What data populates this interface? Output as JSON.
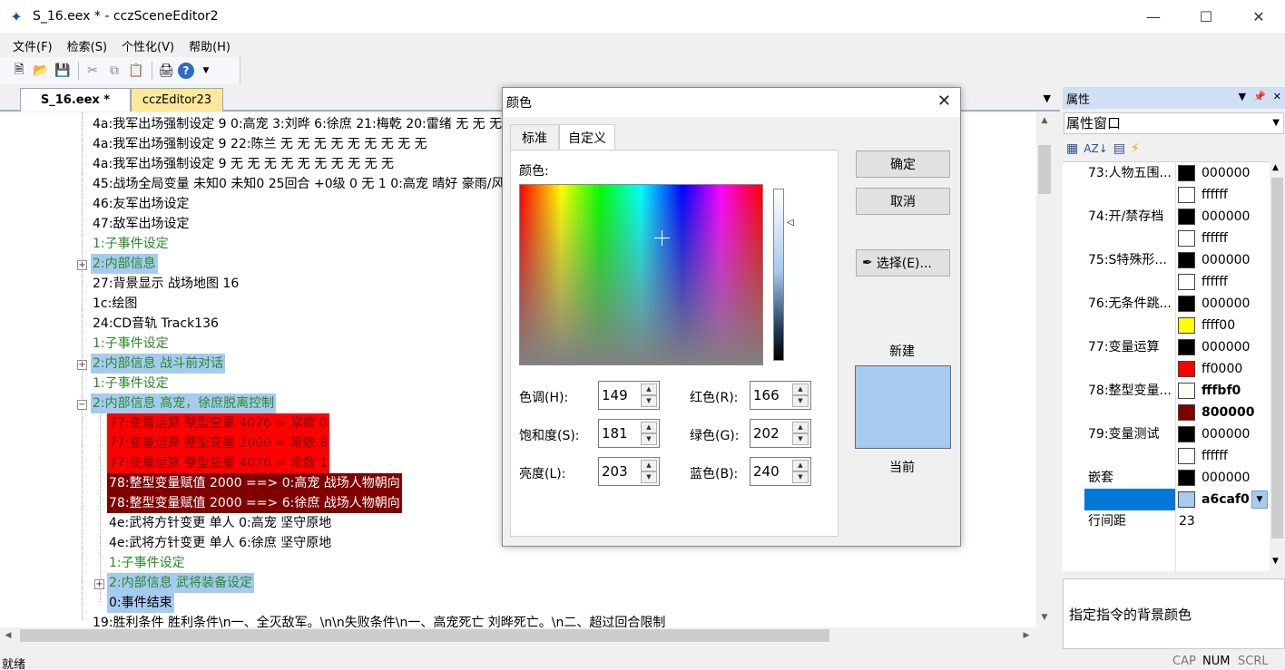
{
  "window": {
    "title": "S_16.eex * - cczSceneEditor2"
  },
  "menu": [
    "文件(F)",
    "检索(S)",
    "个性化(V)",
    "帮助(H)"
  ],
  "tabs": {
    "active": "S_16.eex *",
    "inactive": "cczEditor23"
  },
  "tree": [
    {
      "text": "4a:我军出场强制设定 9 0:高宠 3:刘晔 6:徐庶 21:梅乾 20:雷绪 无 无 无 无 无"
    },
    {
      "text": "4a:我军出场强制设定 9 22:陈兰 无 无 无 无 无 无 无 无 无"
    },
    {
      "text": "4a:我军出场强制设定 9 无 无 无 无 无 无 无 无 无 无"
    },
    {
      "text": "45:战场全局变量 未知0 未知0 25回合 +0级 0 无 1 0:高宠 晴好 豪雨/风"
    },
    {
      "text": "46:友军出场设定"
    },
    {
      "text": "47:敌军出场设定"
    },
    {
      "text": "1:子事件设定"
    },
    {
      "text": "2:内部信息"
    },
    {
      "text": "27:背景显示 战场地图  16"
    },
    {
      "text": "1c:绘图"
    },
    {
      "text": "24:CD音轨 Track136"
    },
    {
      "text": "1:子事件设定"
    },
    {
      "text": "2:内部信息 战斗前对话"
    },
    {
      "text": "1:子事件设定"
    },
    {
      "text": "2:内部信息 高宠，徐庶脱离控制"
    },
    {
      "text": "77:变量运算 整型变量 4076 = 常数 0"
    },
    {
      "text": "77:变量运算 整型变量 2000 = 常数 8"
    },
    {
      "text": "77:变量运算 整型变量 4076 = 常数 1"
    },
    {
      "text": "78:整型变量赋值 2000 ==> 0:高宠 战场人物朝向"
    },
    {
      "text": "78:整型变量赋值 2000 ==> 6:徐庶 战场人物朝向"
    },
    {
      "text": "4e:武将方针变更 单人 0:高宠 坚守原地"
    },
    {
      "text": "4e:武将方针变更 单人 6:徐庶 坚守原地"
    },
    {
      "text": "1:子事件设定"
    },
    {
      "text": "2:内部信息 武将装备设定"
    },
    {
      "text": "0:事件结束"
    },
    {
      "text": "19:胜利条件 胜利条件\\n一、全灭敌军。\\n\\n失败条件\\n一、高宠死亡 刘晔死亡。\\n二、超过回合限制"
    }
  ],
  "status": {
    "text": "就绪",
    "cap": "CAP",
    "num": "NUM",
    "scrl": "SCRL"
  },
  "props": {
    "header": "属性",
    "combo": "属性窗口",
    "rows": [
      {
        "name": "73:人物五围...",
        "swatch": "#000000",
        "value": "000000"
      },
      {
        "name": "",
        "swatch": "#ffffff",
        "value": "ffffff"
      },
      {
        "name": "74:开/禁存档",
        "swatch": "#000000",
        "value": "000000"
      },
      {
        "name": "",
        "swatch": "#ffffff",
        "value": "ffffff"
      },
      {
        "name": "75:S特殊形...",
        "swatch": "#000000",
        "value": "000000"
      },
      {
        "name": "",
        "swatch": "#ffffff",
        "value": "ffffff"
      },
      {
        "name": "76:无条件跳...",
        "swatch": "#000000",
        "value": "000000"
      },
      {
        "name": "",
        "swatch": "#ffff00",
        "value": "ffff00"
      },
      {
        "name": "77:变量运算",
        "swatch": "#000000",
        "value": "000000"
      },
      {
        "name": "",
        "swatch": "#ff0000",
        "value": "ff0000"
      },
      {
        "name": "78:整型变量...",
        "swatch": "#fffbf0",
        "value": "fffbf0",
        "bold": true
      },
      {
        "name": "",
        "swatch": "#800000",
        "value": "800000",
        "bold": true
      },
      {
        "name": "79:变量测试",
        "swatch": "#000000",
        "value": "000000"
      },
      {
        "name": "",
        "swatch": "#ffffff",
        "value": "ffffff"
      },
      {
        "name": "嵌套",
        "swatch": "#000000",
        "value": "000000"
      },
      {
        "name": "",
        "swatch": "#a6caf0",
        "value": "a6caf0",
        "bold": true,
        "selected": true
      },
      {
        "name": "行间距",
        "value": "23"
      }
    ],
    "description": "指定指令的背景颜色"
  },
  "dialog": {
    "title": "颜色",
    "tab_standard": "标准",
    "tab_custom": "自定义",
    "color_label": "颜色:",
    "hue_label": "色调(H):",
    "hue": "149",
    "sat_label": "饱和度(S):",
    "sat": "181",
    "lum_label": "亮度(L):",
    "lum": "203",
    "red_label": "红色(R):",
    "red": "166",
    "green_label": "绿色(G):",
    "green": "202",
    "blue_label": "蓝色(B):",
    "blue": "240",
    "ok": "确定",
    "cancel": "取消",
    "pick": "选择(E)...",
    "new_label": "新建",
    "current_label": "当前",
    "preview_color": "#a6caf0"
  }
}
